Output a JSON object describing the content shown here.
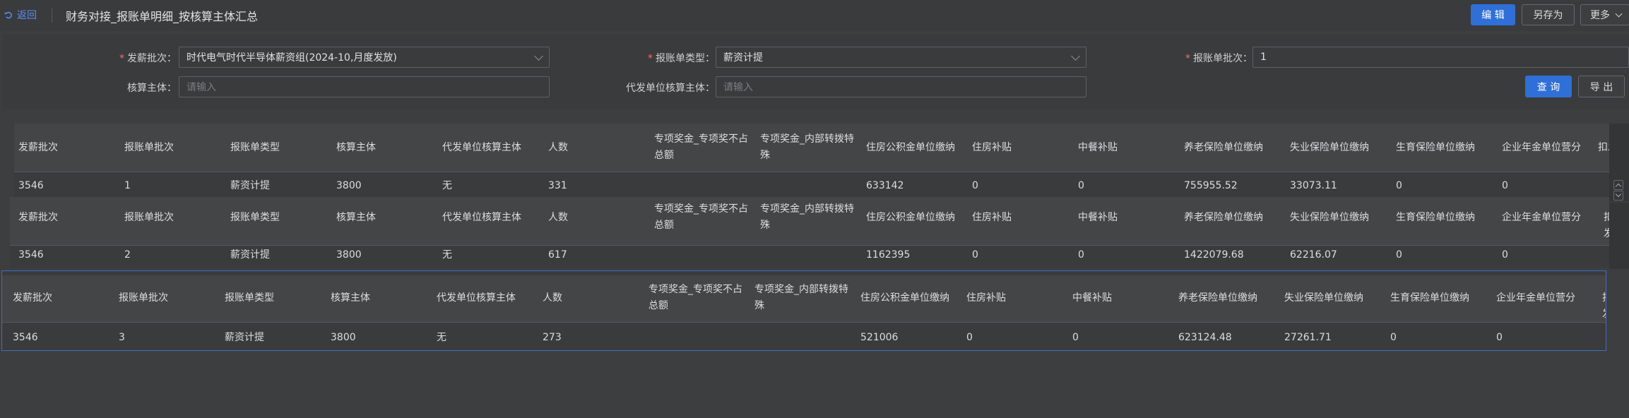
{
  "topbar": {
    "back_label": "返回",
    "title": "财务对接_报账单明细_按核算主体汇总",
    "edit_label": "编 辑",
    "saveas_label": "另存为",
    "more_label": "更多"
  },
  "filters": {
    "batch_label": "发薪批次：",
    "batch_value": "时代电气时代半导体薪资组(2024-10,月度发放)",
    "type_label": "报账单类型：",
    "type_value": "薪资计提",
    "reimb_batch_label": "报账单批次：",
    "reimb_batch_value": "1",
    "entity_label": "核算主体：",
    "entity_placeholder": "请输入",
    "agent_label": "代发单位核算主体：",
    "agent_placeholder": "请输入",
    "query_label": "查 询",
    "export_label": "导 出"
  },
  "columns": [
    "发薪批次",
    "报账单批次",
    "报账单类型",
    "核算主体",
    "代发单位核算主体",
    "人数",
    "专项奖金_专项奖不占总额",
    "专项奖金_内部转拨特殊",
    "住房公积金单位缴纳",
    "住房补贴",
    "中餐补贴",
    "养老保险单位缴纳",
    "失业保险单位缴纳",
    "生育保险单位缴纳",
    "企业年金单位营分",
    "扣发"
  ],
  "tables": [
    {
      "row": [
        "3546",
        "1",
        "薪资计提",
        "3800",
        "无",
        "331",
        "",
        "",
        "633142",
        "0",
        "0",
        "755955.52",
        "33073.11",
        "0",
        "0",
        ""
      ]
    },
    {
      "row": [
        "3546",
        "2",
        "薪资计提",
        "3800",
        "无",
        "617",
        "",
        "",
        "1162395",
        "0",
        "0",
        "1422079.68",
        "62216.07",
        "0",
        "0",
        ""
      ]
    },
    {
      "row": [
        "3546",
        "3",
        "薪资计提",
        "3800",
        "无",
        "273",
        "",
        "",
        "521006",
        "0",
        "0",
        "623124.48",
        "27261.71",
        "0",
        "0",
        ""
      ]
    }
  ],
  "colors": {
    "accent": "#2f6fd8",
    "link": "#5b8ff9",
    "required": "#f56c6c",
    "selected_border": "#3b6fc4"
  }
}
